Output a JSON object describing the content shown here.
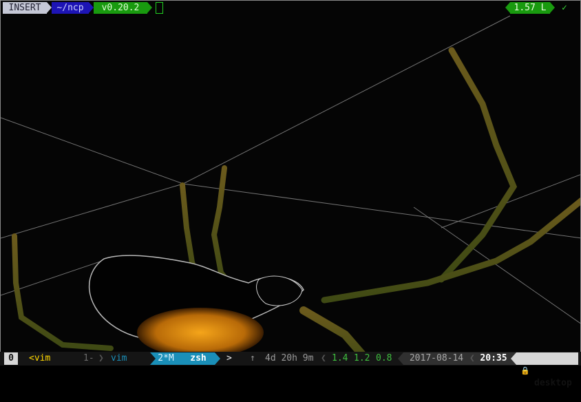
{
  "prompt": {
    "mode": "INSERT",
    "path": "~/ncp",
    "version": "v0.20.2",
    "load": "1.57 L",
    "status_icon": "✓"
  },
  "tmux": {
    "session": "0",
    "windows": [
      {
        "label": "<vim",
        "state": "previous"
      },
      {
        "label": "1-",
        "state": "inactive"
      },
      {
        "label": "vim",
        "state": "inactive"
      },
      {
        "label": "2*M",
        "state": "active-index"
      },
      {
        "label": "zsh",
        "state": "active"
      }
    ],
    "prompt_arrow": ">",
    "up_arrow": "↑",
    "uptime": "4d 20h 9m",
    "load_avg": [
      "1.4",
      "1.2",
      "0.8"
    ],
    "date": "2017-08-14",
    "time": "20:35",
    "host": "desktop",
    "lock_icon": "🔒"
  },
  "colors": {
    "mode_bg": "#c5c8d6",
    "path_bg": "#1d14b5",
    "version_bg": "#199a0f",
    "load_bg": "#199a0f",
    "tmux_active": "#1a8fb8",
    "tmux_host_bg": "#d7d7d7"
  },
  "wallpaper": "spider-on-web-photo"
}
